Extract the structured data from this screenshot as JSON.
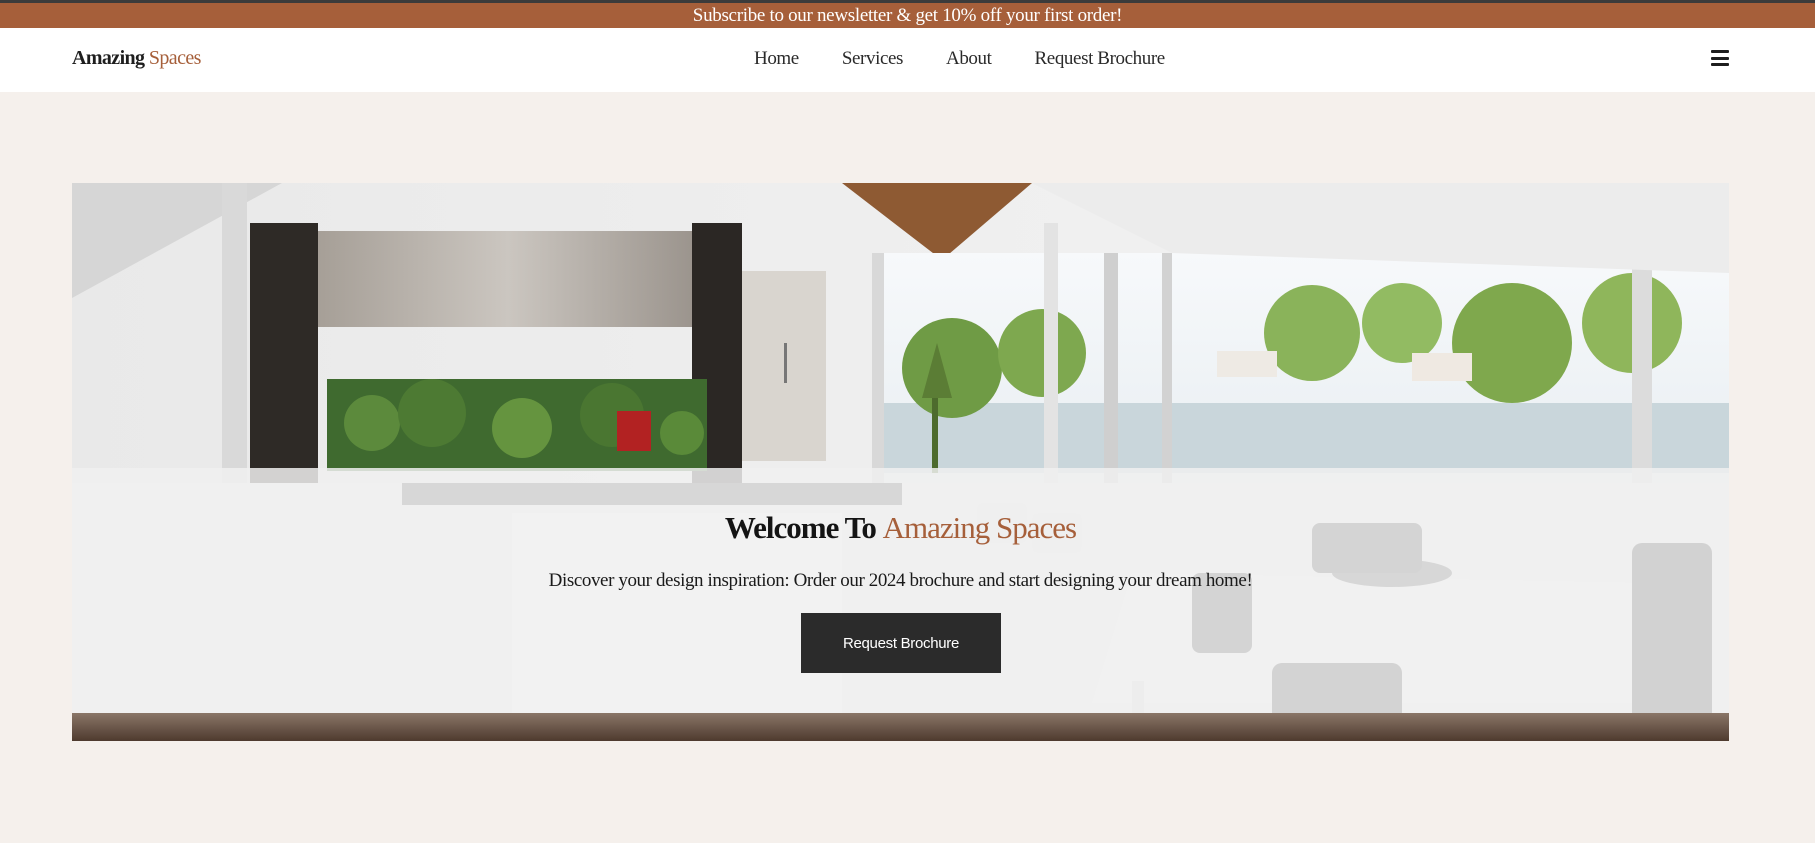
{
  "promo": {
    "text": "Subscribe to our newsletter & get 10% off your first order!"
  },
  "header": {
    "logo_main": "Amazing",
    "logo_accent": "Spaces",
    "nav": [
      {
        "label": "Home"
      },
      {
        "label": "Services"
      },
      {
        "label": "About"
      },
      {
        "label": "Request Brochure"
      }
    ],
    "menu_icon": "hamburger-menu-icon"
  },
  "hero": {
    "title_prefix": "Welcome To",
    "title_accent": "Amazing Spaces",
    "subtitle": "Discover your design inspiration: Order our 2024 brochure and start designing your dream home!",
    "button_label": "Request Brochure",
    "image": "modern-kitchen-photo"
  },
  "colors": {
    "accent": "#a65f3a",
    "background": "#f5f0ec",
    "button": "#2b2b2b",
    "promo_border": "#3b3b3b"
  }
}
